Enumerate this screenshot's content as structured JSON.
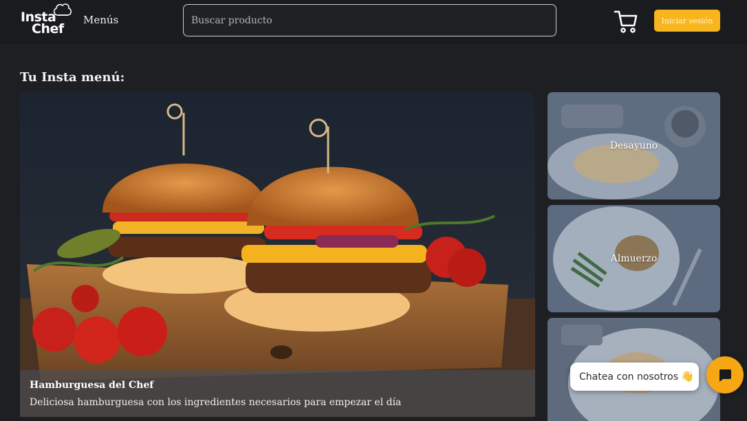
{
  "header": {
    "logo_text_1": "Insta",
    "logo_text_2": "Chef",
    "menu_label": "Menús",
    "search_placeholder": "Buscar producto",
    "login_label": "Iniciar sesión",
    "icons": [
      "chef-hat-icon",
      "cart-icon"
    ]
  },
  "main": {
    "section_title": "Tu Insta menú:",
    "featured": {
      "title": "Hamburguesa del Chef",
      "description": "Deliciosa hamburguesa con los ingredientes necesarios para empezar el día"
    },
    "categories": [
      {
        "label": "Desayuno"
      },
      {
        "label": "Almuerzo"
      },
      {
        "label": ""
      }
    ]
  },
  "chat": {
    "label": "Chatea con nosotros",
    "emoji": "👋",
    "icons": [
      "chat-icon"
    ]
  },
  "colors": {
    "background": "#1e1f22",
    "accent": "#f7b51e",
    "chat_accent": "#f7a614"
  }
}
